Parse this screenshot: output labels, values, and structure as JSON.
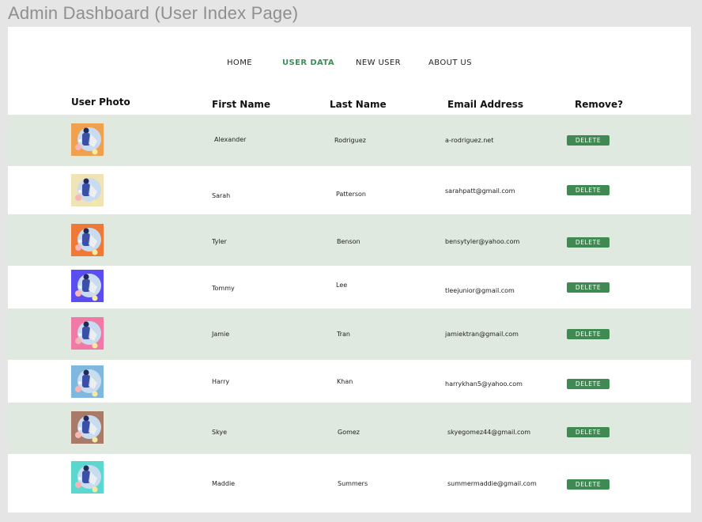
{
  "frame_title": "Admin Dashboard (User Index Page)",
  "nav": {
    "home": "HOME",
    "user_data": "USER DATA",
    "new_user": "NEW USER",
    "about_us": "ABOUT US",
    "active_color": "#3a8f5a"
  },
  "table": {
    "headers": {
      "photo": "User Photo",
      "first_name": "First Name",
      "last_name": "Last Name",
      "email": "Email Address",
      "remove": "Remove?"
    },
    "delete_label": "DELETE",
    "rows": [
      {
        "first": "Alexander",
        "last": "Rodriguez",
        "email": "a-rodriguez.net",
        "avatar_bg": "#f0a150",
        "avatar_icon": "person-avatar-icon"
      },
      {
        "first": "Sarah",
        "last": "Patterson",
        "email": "sarahpatt@gmail.com",
        "avatar_bg": "#f0e3b5",
        "avatar_icon": "person-avatar-icon"
      },
      {
        "first": "Tyler",
        "last": "Benson",
        "email": "bensytyler@yahoo.com",
        "avatar_bg": "#ef7a37",
        "avatar_icon": "person-avatar-icon"
      },
      {
        "first": "Tommy",
        "last": "Lee",
        "email": "tleejunior@gmail.com",
        "avatar_bg": "#5a4ef0",
        "avatar_icon": "person-avatar-icon"
      },
      {
        "first": "Jamie",
        "last": "Tran",
        "email": "jamiektran@gmail.com",
        "avatar_bg": "#f07aa5",
        "avatar_icon": "person-avatar-icon"
      },
      {
        "first": "Harry",
        "last": "Khan",
        "email": "harrykhan5@yahoo.com",
        "avatar_bg": "#7fb7df",
        "avatar_icon": "person-avatar-icon"
      },
      {
        "first": "Skye",
        "last": "Gomez",
        "email": "skyegomez44@gmail.com",
        "avatar_bg": "#a87a68",
        "avatar_icon": "person-avatar-icon"
      },
      {
        "first": "Maddie",
        "last": "Summers",
        "email": "summermaddie@gmail.com",
        "avatar_bg": "#5ad8cf",
        "avatar_icon": "person-avatar-icon"
      }
    ]
  },
  "colors": {
    "row_tint": "#e0e9e0",
    "delete_button": "#3f8a52"
  }
}
